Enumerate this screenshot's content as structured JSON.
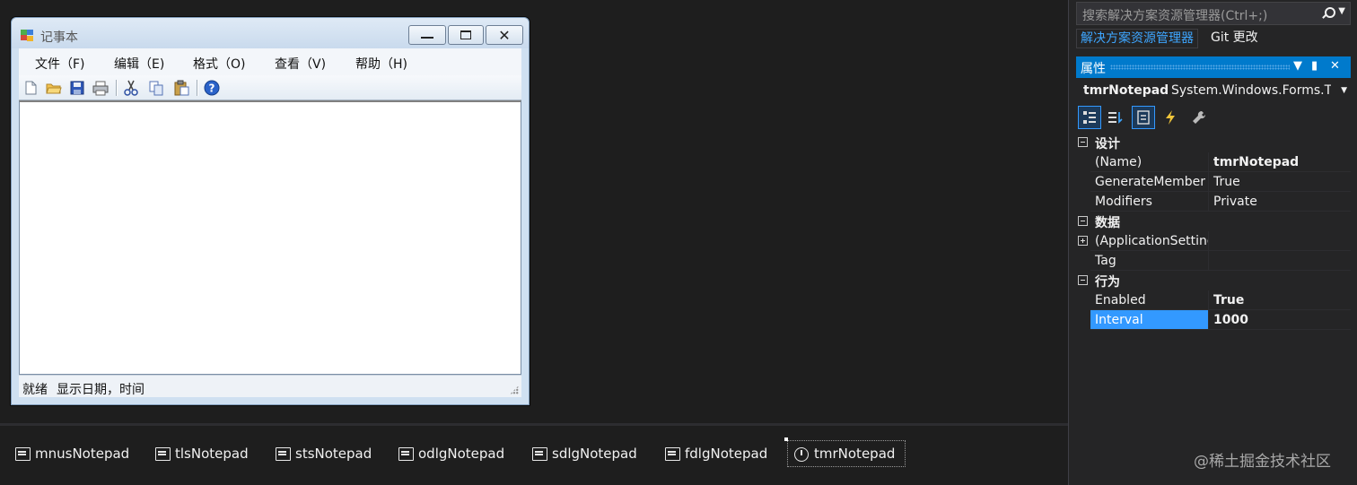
{
  "form": {
    "title": "记事本",
    "menu": [
      "文件（F)",
      "编辑（E)",
      "格式（O)",
      "查看（V)",
      "帮助（H)"
    ],
    "status": [
      "就绪",
      "显示日期，时间"
    ]
  },
  "tray": {
    "items": [
      "mnusNotepad",
      "tlsNotepad",
      "stsNotepad",
      "odlgNotepad",
      "sdlgNotepad",
      "fdlgNotepad",
      "tmrNotepad"
    ]
  },
  "solution": {
    "search_placeholder": "搜索解决方案资源管理器(Ctrl+;)",
    "tab_solution": "解决方案资源管理器",
    "tab_git": "Git 更改"
  },
  "properties": {
    "title": "属性",
    "object_name": "tmrNotepad",
    "object_type": "System.Windows.Forms.T",
    "categories": [
      {
        "label": "设计",
        "rows": [
          {
            "name": "(Name)",
            "value": "tmrNotepad"
          },
          {
            "name": "GenerateMember",
            "value": "True"
          },
          {
            "name": "Modifiers",
            "value": "Private"
          }
        ]
      },
      {
        "label": "数据",
        "rows": [
          {
            "name": "(ApplicationSettings)",
            "value": ""
          },
          {
            "name": "Tag",
            "value": ""
          }
        ]
      },
      {
        "label": "行为",
        "rows": [
          {
            "name": "Enabled",
            "value": "True"
          },
          {
            "name": "Interval",
            "value": "1000"
          }
        ]
      }
    ]
  },
  "watermark": "@稀土掘金技术社区",
  "colors": {
    "accent": "#007acc",
    "selection": "#3399ff",
    "background": "#1e1e1e",
    "panel": "#252526"
  }
}
